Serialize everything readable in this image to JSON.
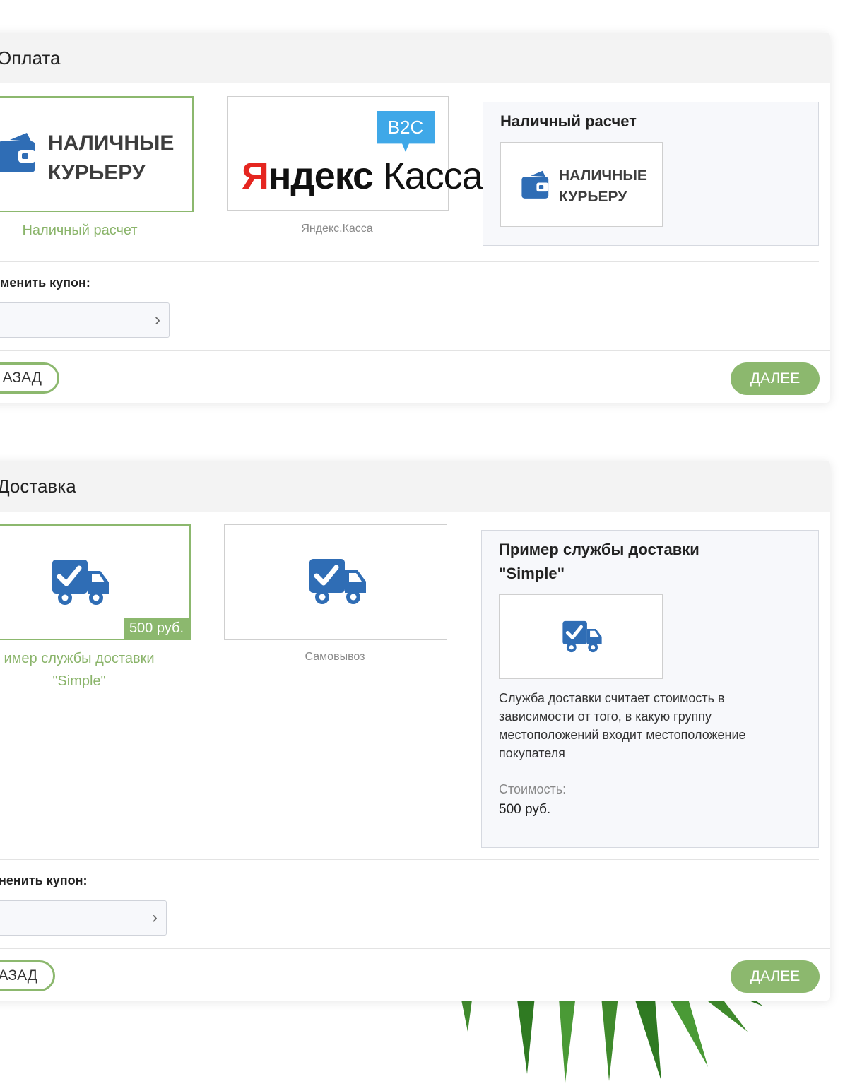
{
  "payment": {
    "title": "Оплата",
    "options": [
      {
        "logo_line1": "НАЛИЧНЫЕ",
        "logo_line2": "КУРЬЕРУ",
        "label": "Наличный расчет",
        "selected": true
      },
      {
        "badge": "B2C",
        "logo_red": "Я",
        "logo_black": "ндекс",
        "logo_rest": "Касса",
        "label": "Яндекс.Касса",
        "selected": false
      }
    ],
    "info": {
      "title": "Наличный расчет",
      "thumb_line1": "НАЛИЧНЫЕ",
      "thumb_line2": "КУРЬЕРУ"
    },
    "coupon_label": "менить купон:",
    "coupon_value": "",
    "back_label": "АЗАД",
    "next_label": "ДАЛЕЕ"
  },
  "delivery": {
    "title": "Доставка",
    "options": [
      {
        "price": "500 руб.",
        "label_line1": "имер службы доставки",
        "label_line2": "\"Simple\"",
        "selected": true,
        "icon": "delivery-truck-icon"
      },
      {
        "label": "Самовывоз",
        "selected": false,
        "icon": "delivery-truck-icon"
      }
    ],
    "info": {
      "title_line1": "Пример службы доставки",
      "title_line2": "\"Simple\"",
      "description": "Служба доставки считает стоимость в зависимости от того, в какую группу местоположений входит местоположение покупателя",
      "cost_label": "Стоимость:",
      "cost_value": "500 руб."
    },
    "coupon_label": "ненить купон:",
    "coupon_value": "",
    "back_label": "АЗАД",
    "next_label": "ДАЛЕЕ"
  },
  "colors": {
    "accent": "#8cb86e",
    "icon_blue": "#2f6db5",
    "yandex_red": "#e52620",
    "badge_blue": "#3fa8e8"
  }
}
